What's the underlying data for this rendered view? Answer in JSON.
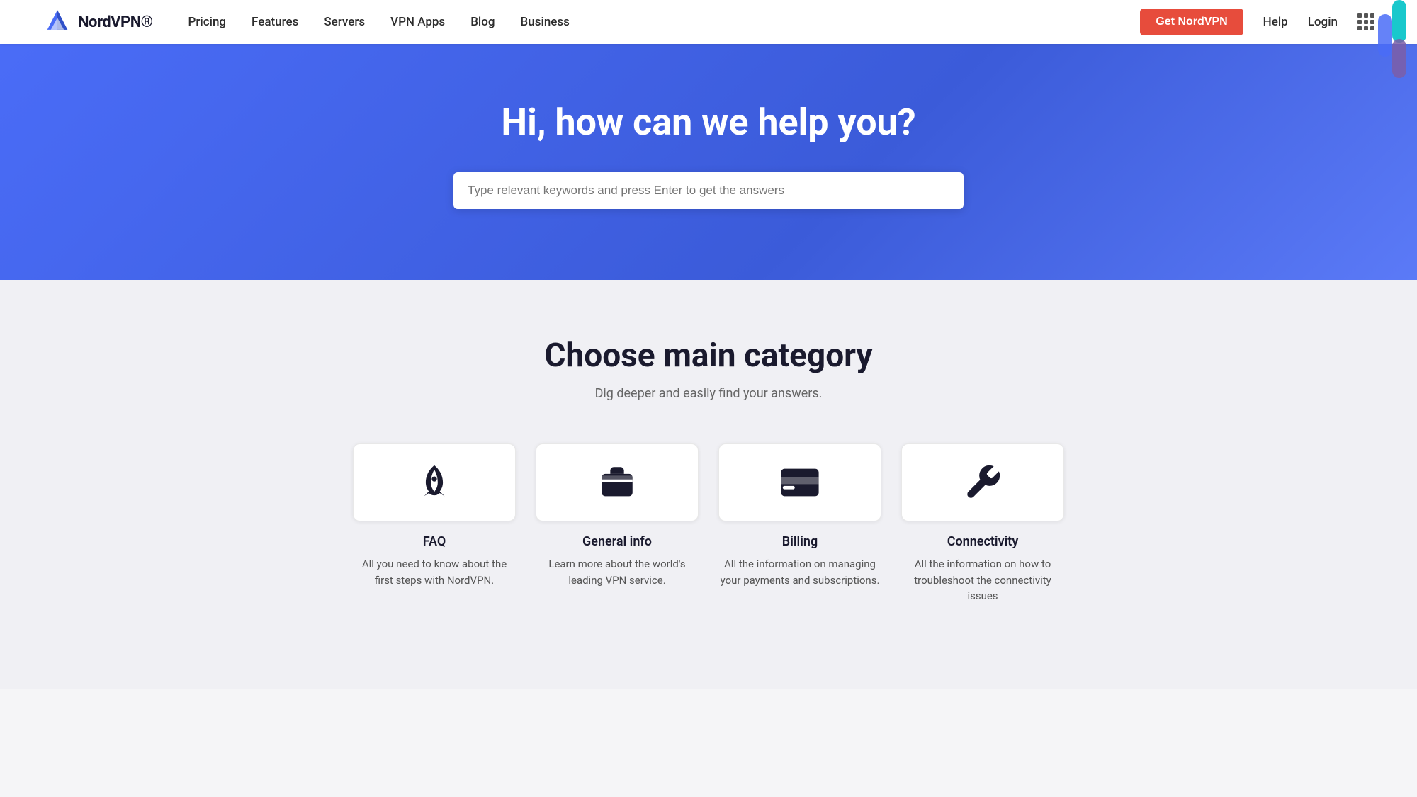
{
  "navbar": {
    "logo_text": "NordVPN®",
    "nav_links": [
      {
        "label": "Pricing",
        "id": "pricing"
      },
      {
        "label": "Features",
        "id": "features"
      },
      {
        "label": "Servers",
        "id": "servers"
      },
      {
        "label": "VPN Apps",
        "id": "vpn-apps"
      },
      {
        "label": "Blog",
        "id": "blog"
      },
      {
        "label": "Business",
        "id": "business"
      }
    ],
    "cta_button": "Get NordVPN",
    "help_label": "Help",
    "login_label": "Login"
  },
  "hero": {
    "title": "Hi, how can we help you?",
    "search_placeholder": "Type relevant keywords and press Enter to get the answers"
  },
  "categories": {
    "section_title": "Choose main category",
    "section_subtitle": "Dig deeper and easily find your answers.",
    "items": [
      {
        "id": "faq",
        "label": "FAQ",
        "description": "All you need to know about the first steps with NordVPN.",
        "icon": "🚀"
      },
      {
        "id": "general-info",
        "label": "General info",
        "description": "Learn more about the world's leading VPN service.",
        "icon": "🗂"
      },
      {
        "id": "billing",
        "label": "Billing",
        "description": "All the information on managing your payments and subscriptions.",
        "icon": "💳"
      },
      {
        "id": "connectivity",
        "label": "Connectivity",
        "description": "All the information on how to troubleshoot the connectivity issues",
        "icon": "🔧"
      }
    ]
  },
  "colors": {
    "hero_bg": "#4a6cf7",
    "cta_bg": "#e74c3c",
    "card_bg": "#ffffff",
    "body_bg": "#f0f0f4"
  }
}
